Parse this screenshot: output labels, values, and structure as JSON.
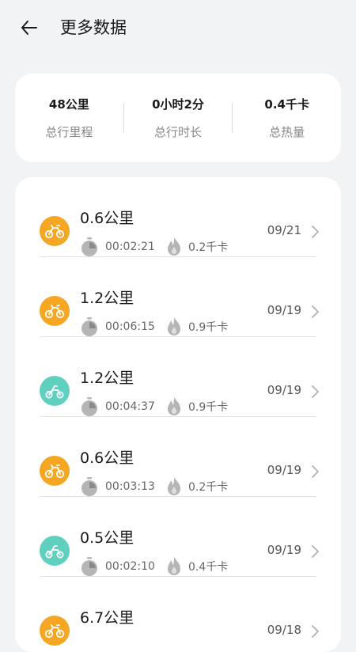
{
  "header": {
    "title": "更多数据"
  },
  "summary": [
    {
      "value": "48公里",
      "label": "总行里程"
    },
    {
      "value": "0小时2分",
      "label": "总行时长"
    },
    {
      "value": "0.4千卡",
      "label": "总热量"
    }
  ],
  "colors": {
    "orange": "#f5a623",
    "teal": "#5fd0c0"
  },
  "rides": [
    {
      "distance": "0.6公里",
      "duration": "00:02:21",
      "calories": "0.2千卡",
      "date": "09/21",
      "type": "orange"
    },
    {
      "distance": "1.2公里",
      "duration": "00:06:15",
      "calories": "0.9千卡",
      "date": "09/19",
      "type": "orange"
    },
    {
      "distance": "1.2公里",
      "duration": "00:04:37",
      "calories": "0.9千卡",
      "date": "09/19",
      "type": "teal"
    },
    {
      "distance": "0.6公里",
      "duration": "00:03:13",
      "calories": "0.2千卡",
      "date": "09/19",
      "type": "orange"
    },
    {
      "distance": "0.5公里",
      "duration": "00:02:10",
      "calories": "0.4千卡",
      "date": "09/19",
      "type": "teal"
    },
    {
      "distance": "6.7公里",
      "duration": "",
      "calories": "",
      "date": "09/18",
      "type": "orange"
    }
  ]
}
